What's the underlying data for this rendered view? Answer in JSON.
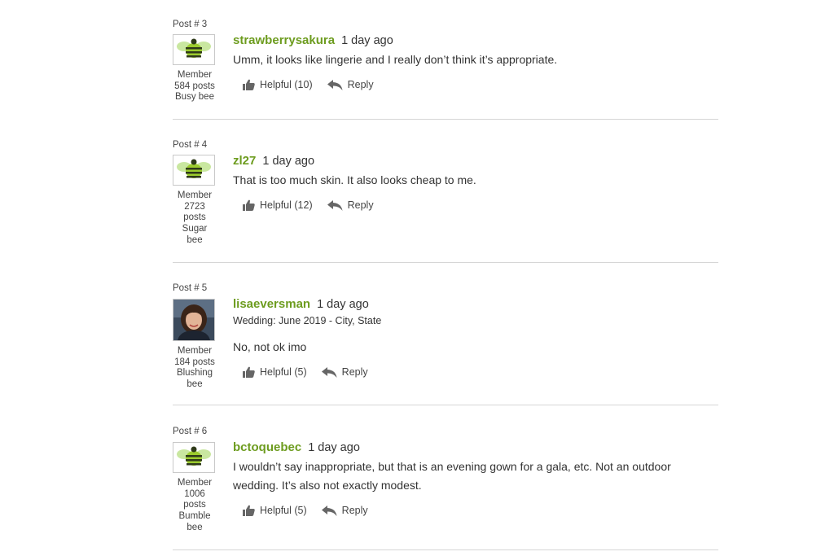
{
  "member_label": "Member",
  "helpful_label": "Helpful",
  "reply_label": "Reply",
  "posts": [
    {
      "post_number": "Post # 3",
      "username": "strawberrysakura",
      "time": "1 day ago",
      "avatar": "bee-avatar-icon",
      "member_type": "Member",
      "post_count": "584 posts",
      "rank_lines": [
        "Busy bee"
      ],
      "wedding": "",
      "text": "Umm, it looks like lingerie and I really don’t think it’s appropriate.",
      "helpful": "Helpful (10)"
    },
    {
      "post_number": "Post # 4",
      "username": "zl27",
      "time": "1 day ago",
      "avatar": "bee-avatar-icon",
      "member_type": "Member",
      "post_count": "2723 posts",
      "rank_lines": [
        "Sugar",
        "bee"
      ],
      "wedding": "",
      "text": "That is too much skin. It also looks cheap to me.",
      "helpful": "Helpful (12)"
    },
    {
      "post_number": "Post # 5",
      "username": "lisaeversman",
      "time": "1 day ago",
      "avatar": "user-photo",
      "member_type": "Member",
      "post_count": "184 posts",
      "rank_lines": [
        "Blushing",
        "bee"
      ],
      "wedding": "Wedding: June 2019 - City, State",
      "text": "No, not ok imo",
      "helpful": "Helpful (5)"
    },
    {
      "post_number": "Post # 6",
      "username": "bctoquebec",
      "time": "1 day ago",
      "avatar": "bee-avatar-icon",
      "member_type": "Member",
      "post_count": "1006 posts",
      "rank_lines": [
        "Bumble",
        "bee"
      ],
      "wedding": "",
      "text_lines": [
        "I wouldn’t say inappropriate, but that is an evening gown for a gala, etc. Not an outdoor",
        "wedding. It’s also not exactly modest."
      ],
      "helpful": "Helpful (5)"
    }
  ],
  "colors": {
    "username": "#6d9c1f",
    "bee_body": "#9ccc2e",
    "bee_wings": "#c9e7a0",
    "divider": "#d6d6d6"
  }
}
